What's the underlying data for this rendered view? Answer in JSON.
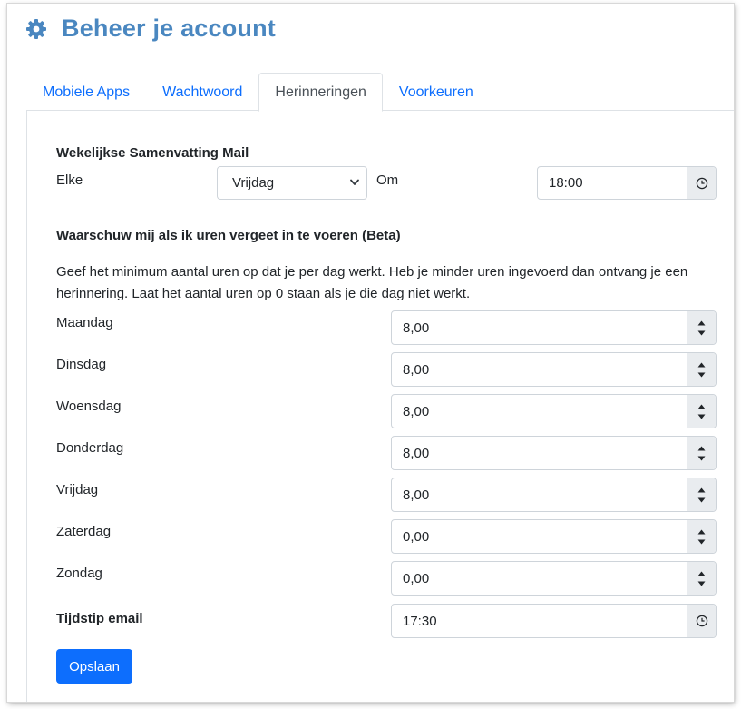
{
  "page": {
    "title": "Beheer je account"
  },
  "tabs": [
    {
      "label": "Mobiele Apps",
      "active": false
    },
    {
      "label": "Wachtwoord",
      "active": false
    },
    {
      "label": "Herinneringen",
      "active": true
    },
    {
      "label": "Voorkeuren",
      "active": false
    }
  ],
  "weekly": {
    "heading": "Wekelijkse Samenvatting Mail",
    "every_label": "Elke",
    "day_value": "Vrijdag",
    "at_label": "Om",
    "time_value": "18:00"
  },
  "warn": {
    "heading_main": "Waarschuw mij als ik uren vergeet in te voeren",
    "heading_suffix": "(Beta)",
    "description": "Geef het minimum aantal uren op dat je per dag werkt. Heb je minder uren ingevoerd dan ontvang je een herinnering. Laat het aantal uren op 0 staan als je die dag niet werkt.",
    "days": [
      {
        "label": "Maandag",
        "value": "8,00"
      },
      {
        "label": "Dinsdag",
        "value": "8,00"
      },
      {
        "label": "Woensdag",
        "value": "8,00"
      },
      {
        "label": "Donderdag",
        "value": "8,00"
      },
      {
        "label": "Vrijdag",
        "value": "8,00"
      },
      {
        "label": "Zaterdag",
        "value": "0,00"
      },
      {
        "label": "Zondag",
        "value": "0,00"
      }
    ],
    "email_time_label": "Tijdstip email",
    "email_time_value": "17:30"
  },
  "actions": {
    "save_label": "Opslaan"
  },
  "colors": {
    "accent": "#0d6efd",
    "title": "#4a87c0",
    "addon": "#e9ecef"
  },
  "icons": {
    "header": "gear-icon",
    "time": "clock-icon",
    "number": "spinner-arrows-icon",
    "select": "chevron-down-icon"
  }
}
